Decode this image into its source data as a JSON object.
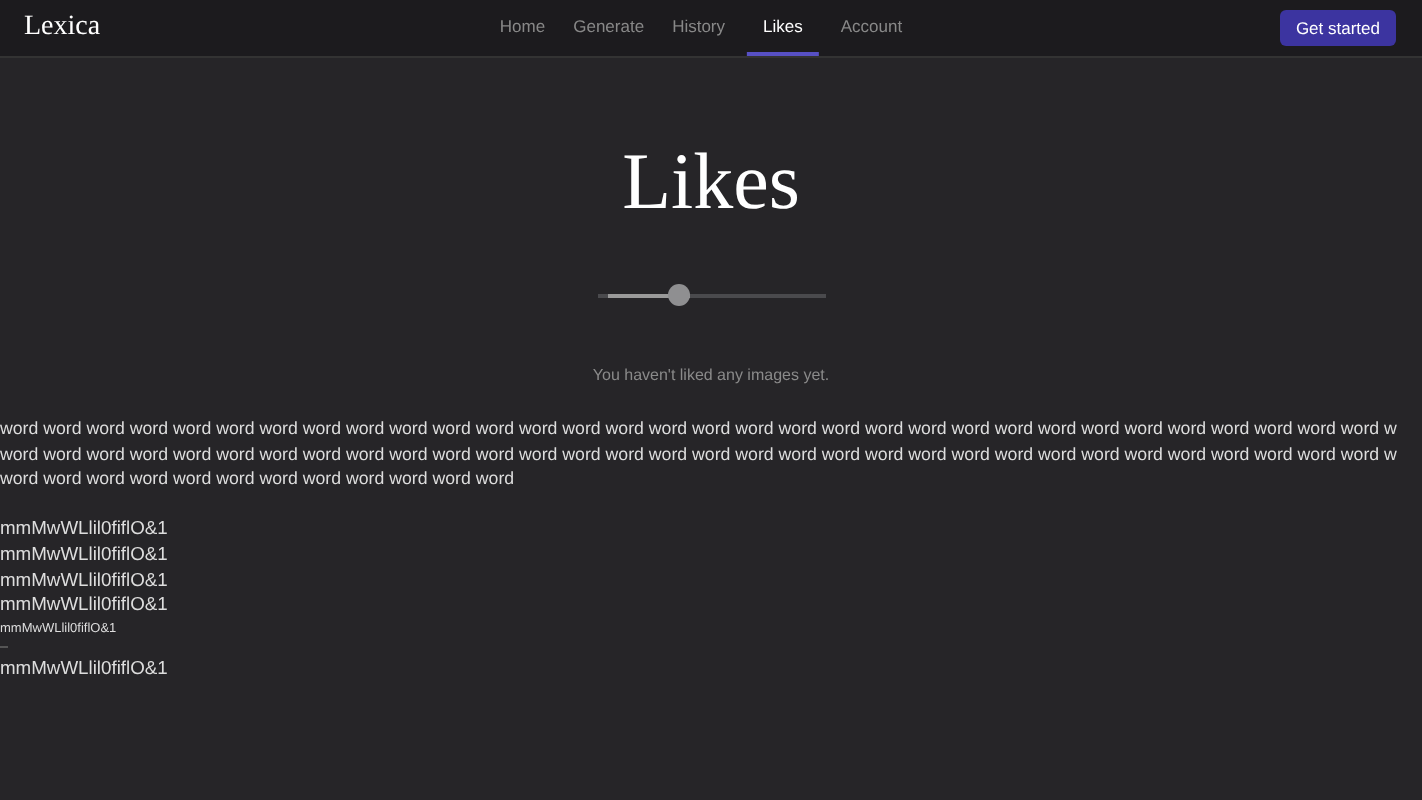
{
  "nav": {
    "logo": "Lexica",
    "links": [
      {
        "label": "Home",
        "selected": false
      },
      {
        "label": "Generate",
        "selected": false
      },
      {
        "label": "History",
        "selected": false
      },
      {
        "label": "Likes",
        "selected": true
      },
      {
        "label": "Account",
        "selected": false
      }
    ],
    "cta": "Get started"
  },
  "heading": "Likes",
  "slider": {
    "level": 0.36
  },
  "empty_message": "You haven't liked any images yet.",
  "word_lines": [
    "word word word word word word word word word word word word word word word word word word word word word word word word word word word word word word word word w",
    "word word word word word word word word word word word word word word word word word word word word word word word word word word word word word word word word w",
    "word word word word word word word word word word word word"
  ],
  "sample_lines": [
    {
      "text": "mmMwWLlil0fiflO&1",
      "kind": "normal"
    },
    {
      "text": "mmMwWLlil0fiflO&1",
      "kind": "normal"
    },
    {
      "text": "mmMwWLlil0fiflO&1",
      "kind": "normal"
    },
    {
      "text": "mmMwWLlil0fiflO&1",
      "kind": "normal"
    },
    {
      "text": "mmMwWLlil0fiflO&1",
      "kind": "small"
    },
    {
      "text": "mmMwWLlil0fiflO&1",
      "kind": "normal"
    }
  ]
}
